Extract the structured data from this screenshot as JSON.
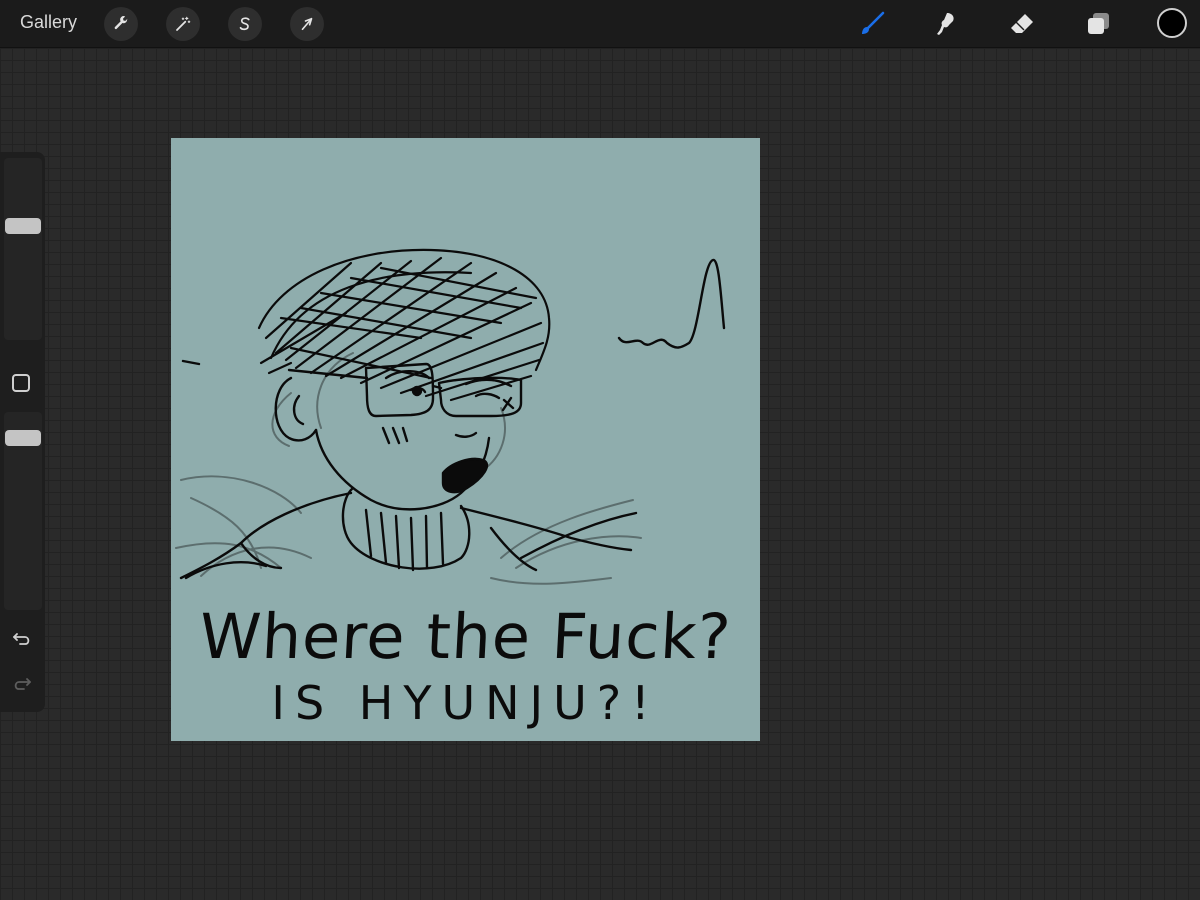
{
  "toolbar": {
    "gallery_label": "Gallery",
    "left_tools": [
      {
        "name": "actions",
        "icon": "wrench-icon"
      },
      {
        "name": "adjustments",
        "icon": "magic-wand-icon"
      },
      {
        "name": "selection",
        "icon": "selection-s-icon"
      },
      {
        "name": "transform",
        "icon": "arrow-cursor-icon"
      }
    ],
    "right_tools": [
      {
        "name": "brush",
        "icon": "brush-icon",
        "active": true
      },
      {
        "name": "smudge",
        "icon": "smudge-icon",
        "active": false
      },
      {
        "name": "eraser",
        "icon": "eraser-icon",
        "active": false
      },
      {
        "name": "layers",
        "icon": "layers-icon",
        "active": false
      }
    ],
    "current_color": "#000000",
    "active_tool_color": "#1a6ee8"
  },
  "sidebar": {
    "brush_size_icon": "slider-handle",
    "modify_icon": "square-icon",
    "undo_icon": "undo-arrow-icon",
    "redo_icon": "redo-arrow-icon"
  },
  "canvas": {
    "background_color": "#8fadad",
    "caption_line_1": "Where the Fuck?",
    "caption_line_2": "IS HYUNJU?!"
  },
  "colors": {
    "toolbar_bg": "#1b1b1b",
    "workspace_bg": "#2a2a2a",
    "ink": "#0b0b0b",
    "sketch_gray": "#5c6e6e"
  }
}
